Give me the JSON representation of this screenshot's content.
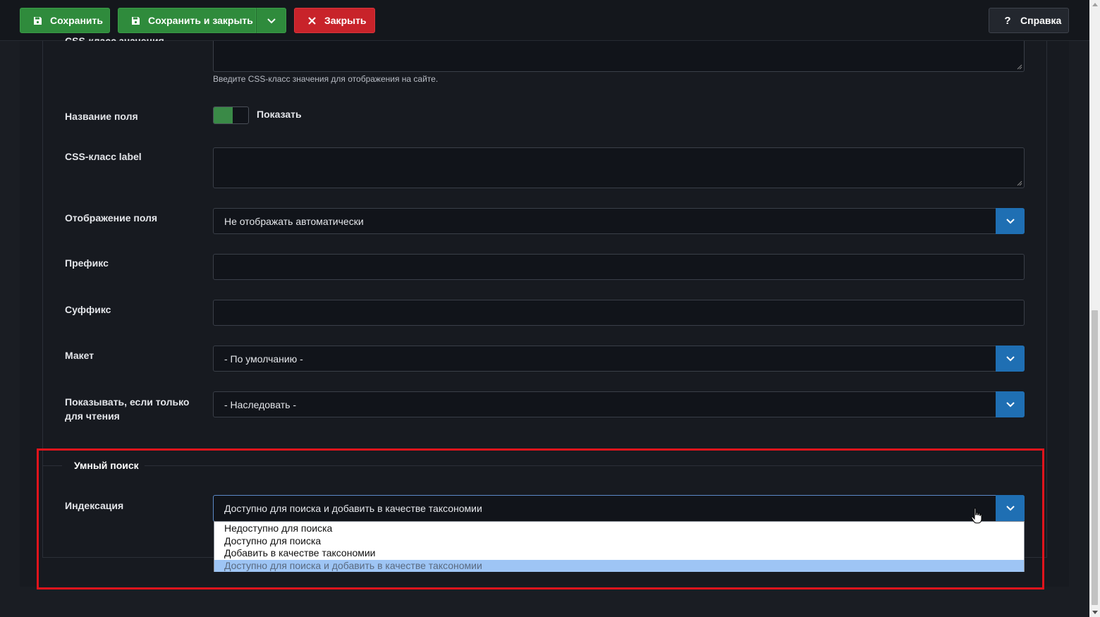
{
  "toolbar": {
    "save_label": "Сохранить",
    "save_close_label": "Сохранить и закрыть",
    "close_label": "Закрыть",
    "help_label": "Справка"
  },
  "form": {
    "css_value_class_label": "CSS-класс значения",
    "css_value_class_hint": "Введите CSS-класс значения для отображения на сайте.",
    "field_name_label": "Название поля",
    "field_name_toggle_text": "Показать",
    "css_label_class_label": "CSS-класс label",
    "field_display_label": "Отображение поля",
    "field_display_value": "Не отображать автоматически",
    "prefix_label": "Префикс",
    "suffix_label": "Суффикс",
    "layout_label": "Макет",
    "layout_value": "- По умолчанию -",
    "show_readonly_label_1": "Показывать, если только",
    "show_readonly_label_2": "для чтения",
    "show_readonly_value": "- Наследовать -"
  },
  "smart_search": {
    "legend": "Умный поиск",
    "indexing_label": "Индексация",
    "indexing_value": "Доступно для поиска и добавить в качестве таксономии",
    "options": [
      "Недоступно для поиска",
      "Доступно для поиска",
      "Добавить в качестве таксономии",
      "Доступно для поиска и добавить в качестве таксономии"
    ],
    "selected_option_index": 3
  },
  "colors": {
    "save_green": "#2f8b3c",
    "close_red": "#c8232a",
    "select_accent": "#1f6fb3",
    "highlight_frame": "#e0141c",
    "option_highlight": "#9ec5f5"
  },
  "icons": {
    "save": "floppy-disk-icon",
    "dropdown": "chevron-down-icon",
    "close": "x-icon",
    "help": "question-mark-icon"
  }
}
